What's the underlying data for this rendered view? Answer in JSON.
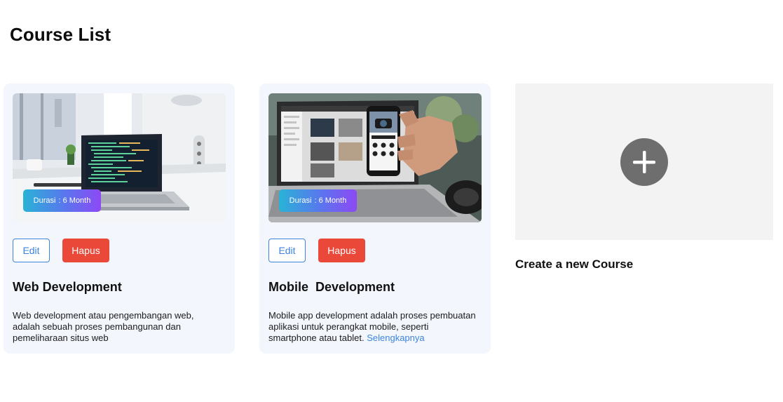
{
  "page": {
    "title": "Course List"
  },
  "courses": [
    {
      "title": "Web Development",
      "duration_label": "Durasi",
      "duration_value": ": 6 Month",
      "edit_label": "Edit",
      "delete_label": "Hapus",
      "description": "Web development atau pengembangan web, adalah sebuah proses pembangunan dan pemeliharaan situs web",
      "read_more": ""
    },
    {
      "title": "Mobile  Development",
      "duration_label": "Durasi",
      "duration_value": ": 6 Month",
      "edit_label": "Edit",
      "delete_label": "Hapus",
      "description": "Mobile app development adalah proses pembuatan aplikasi untuk perangkat mobile, seperti smartphone atau tablet.",
      "read_more": "Selengkapnya"
    }
  ],
  "create": {
    "label": "Create a new Course",
    "icon": "plus-icon"
  },
  "colors": {
    "card_background": "#f3f7fd",
    "edit_border": "#3c84df",
    "delete_background": "#ea4839",
    "badge_gradient_start": "#29b3d6",
    "badge_gradient_end": "#8d49f5",
    "create_tile_background": "#f3f3f3",
    "plus_circle": "#6e6e6e",
    "link": "#3c84df"
  }
}
